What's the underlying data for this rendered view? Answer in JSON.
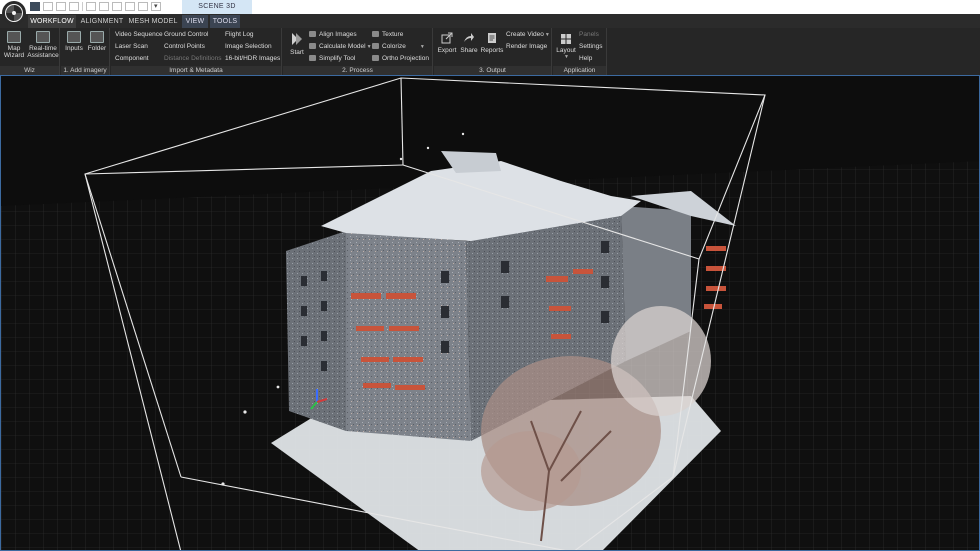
{
  "titlebar": {
    "context_tab": "SCENE 3D",
    "dropdown_glyph": "▾"
  },
  "tabs": [
    {
      "label": "WORKFLOW"
    },
    {
      "label": "ALIGNMENT"
    },
    {
      "label": "MESH MODEL"
    },
    {
      "label": "VIEW"
    },
    {
      "label": "TOOLS"
    }
  ],
  "ribbon": {
    "wiz": {
      "label": "Wiz",
      "map_wizard": "Map\nWizard",
      "map_wizard_l1": "Map",
      "map_wizard_l2": "Wizard",
      "realtime_l1": "Real-time",
      "realtime_l2": "Assistance"
    },
    "add_imagery": {
      "label": "1. Add imagery",
      "inputs": "Inputs",
      "folder": "Folder"
    },
    "import_metadata": {
      "label": "Import & Metadata",
      "col1": [
        "Video Sequence",
        "Laser Scan",
        "Component"
      ],
      "col2": [
        "Ground Control",
        "Control Points",
        "Distance Definitions"
      ],
      "col3": [
        "Flight Log",
        "Image Selection",
        "16-bit/HDR Images"
      ]
    },
    "process": {
      "label": "2. Process",
      "start": "Start",
      "col1": [
        "Align Images",
        "Calculate Model",
        "Simplify Tool"
      ],
      "col2": [
        "Texture",
        "Colorize",
        "Ortho Projection"
      ]
    },
    "output": {
      "label": "3. Output",
      "export": "Export",
      "share": "Share",
      "reports": "Reports",
      "create_video": "Create Video",
      "render_image": "Render Image"
    },
    "application": {
      "label": "Application",
      "layout": "Layout",
      "panels": "Panels",
      "settings": "Settings",
      "help": "Help"
    }
  },
  "colors": {
    "accent": "#3c6aa0",
    "ribbon_bg": "#262626",
    "viewport_bg": "#0d0d0d",
    "context_tab": "#d4e6f5"
  },
  "icons": [
    "app-logo-icon",
    "start-icon",
    "export-icon",
    "share-icon",
    "reports-icon",
    "layout-icon"
  ]
}
